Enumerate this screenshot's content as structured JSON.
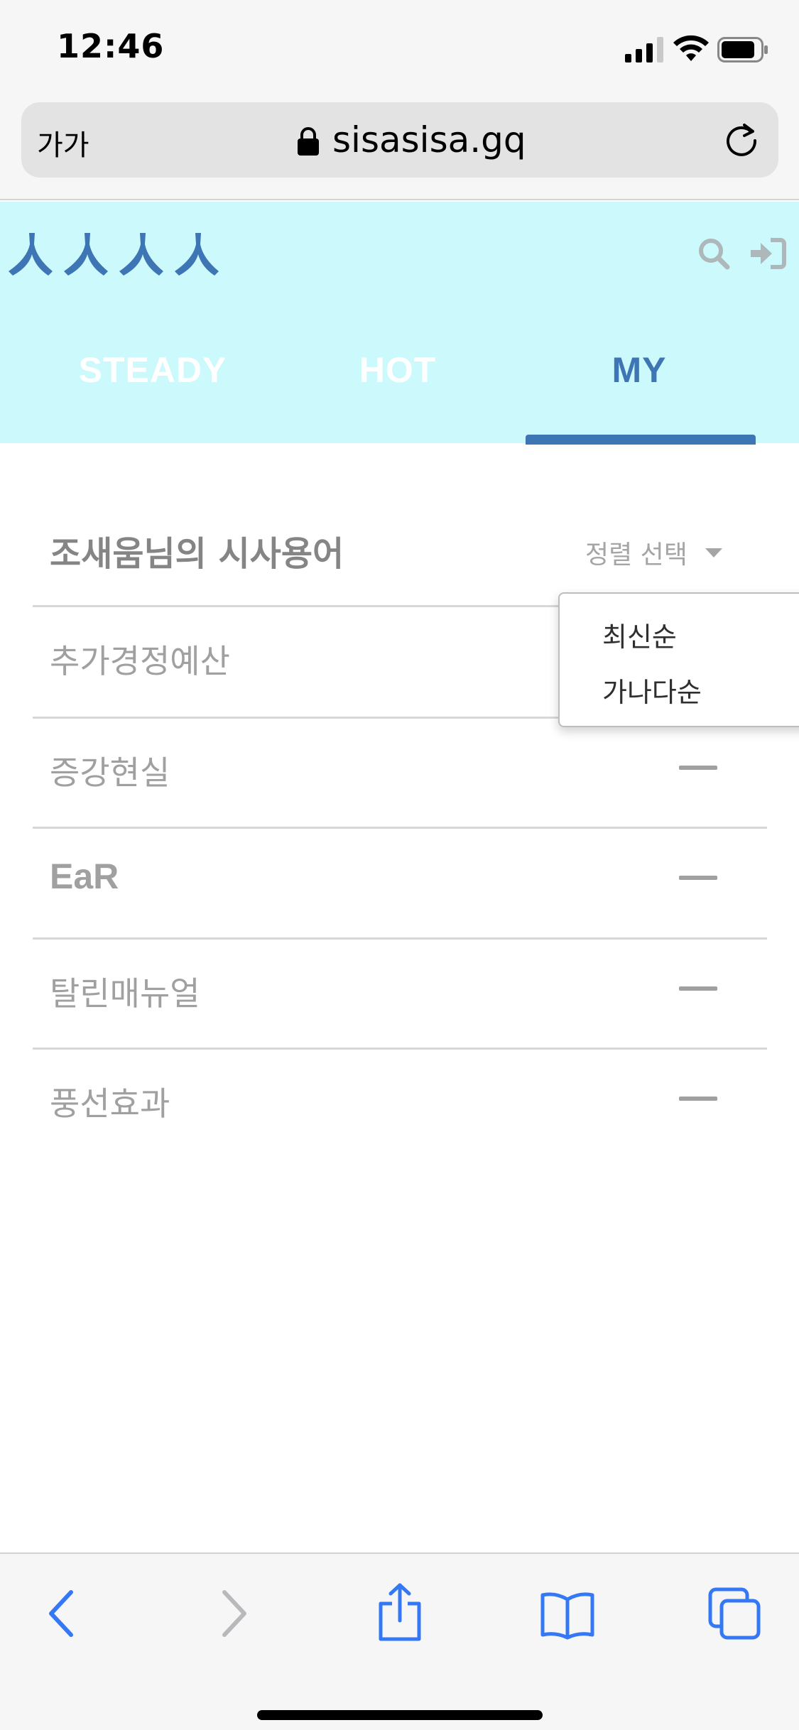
{
  "status_bar": {
    "time": "12:46",
    "icons": [
      "cellular-signal-icon",
      "wifi-icon",
      "battery-icon"
    ]
  },
  "browser": {
    "text_size_button": "가가",
    "domain": "sisasisa.gq",
    "icons": [
      "lock-icon",
      "reload-icon"
    ]
  },
  "header": {
    "logo_text": "ㅅㅅㅅㅅ",
    "icons": [
      "search-icon",
      "login-icon"
    ],
    "tabs": [
      {
        "label": "STEADY",
        "active": false
      },
      {
        "label": "HOT",
        "active": false
      },
      {
        "label": "MY",
        "active": true
      }
    ]
  },
  "main": {
    "section_title": "조새움님의 시사용어",
    "sort_label": "정렬 선택",
    "terms": [
      {
        "label": "추가경정예산"
      },
      {
        "label": "증강현실"
      },
      {
        "label": "EaR"
      },
      {
        "label": "탈린매뉴얼"
      },
      {
        "label": "풍선효과"
      }
    ],
    "sort_options": [
      "최신순",
      "가나다순"
    ]
  },
  "toolbar": {
    "icons": [
      "back-icon",
      "forward-icon",
      "share-icon",
      "bookmarks-icon",
      "tabs-icon"
    ]
  },
  "colors": {
    "header_bg": "#ccf9fb",
    "accent": "#3e75b4",
    "inactive_tab": "#ffffff",
    "browser_chrome": "#f6f6f6",
    "ios_blue": "#3478f6"
  }
}
